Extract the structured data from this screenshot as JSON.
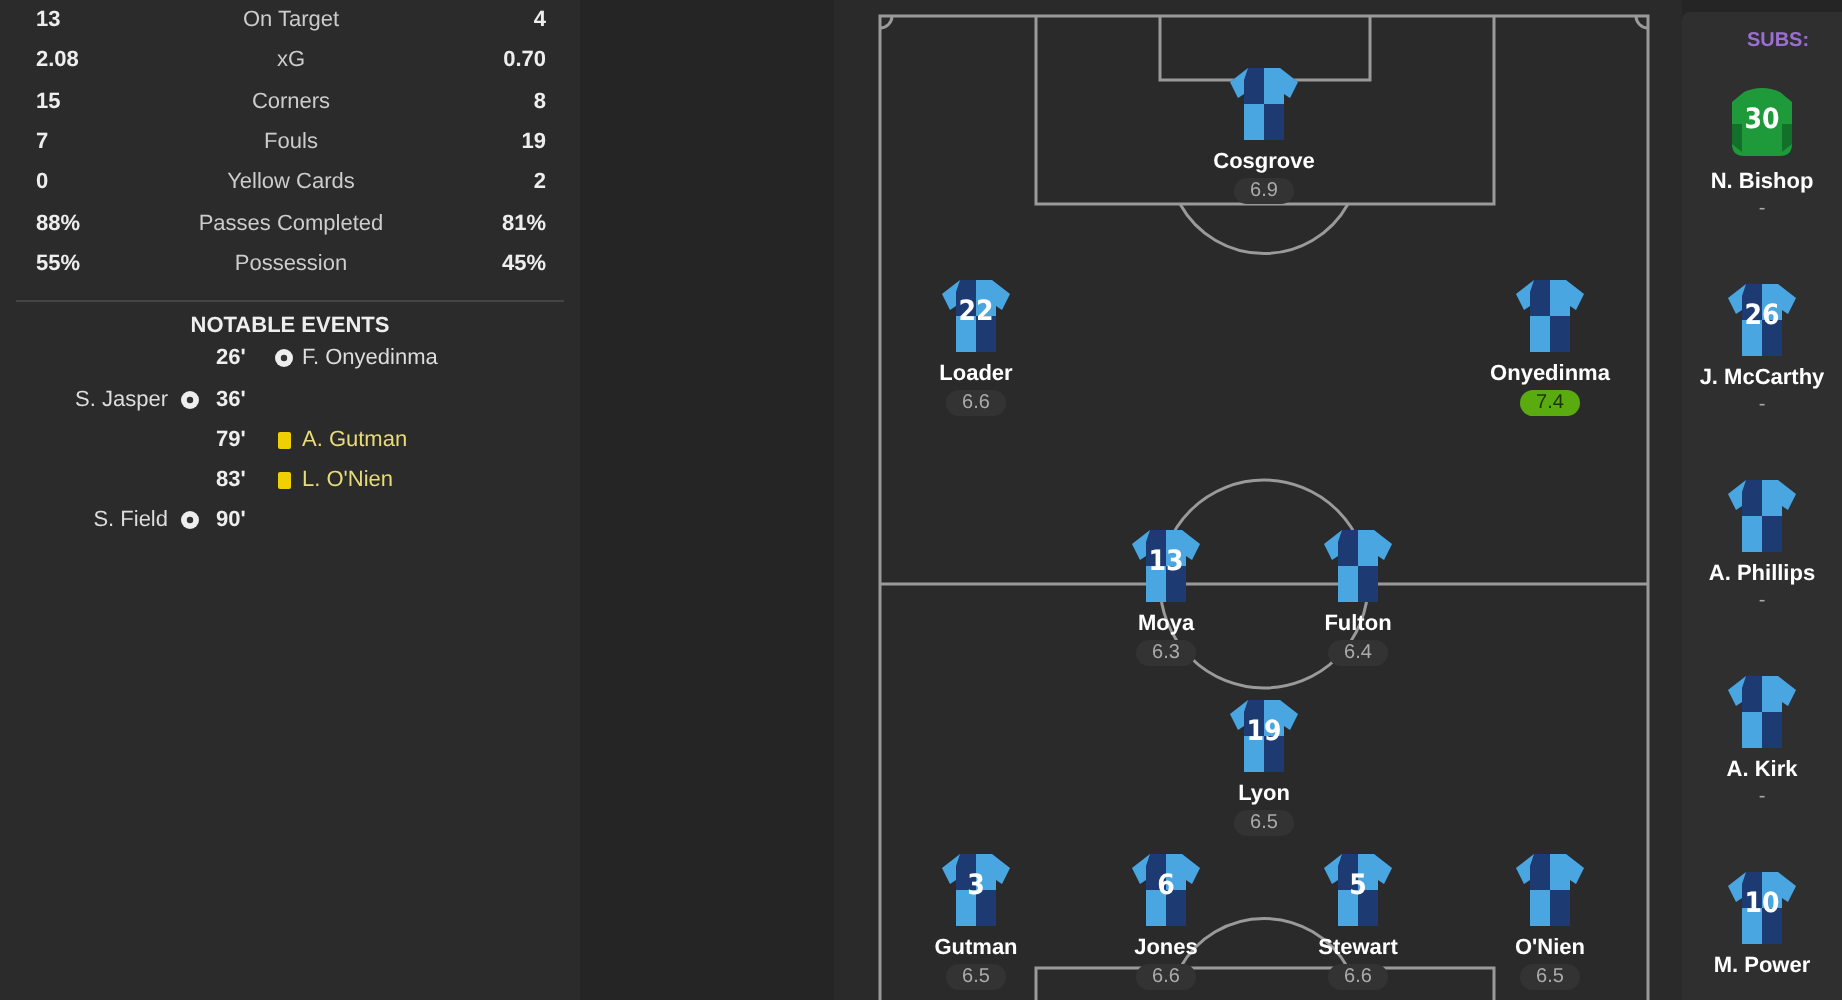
{
  "stats": [
    {
      "home": "13",
      "label": "On Target",
      "away": "4"
    },
    {
      "home": "2.08",
      "label": "xG",
      "away": "0.70"
    },
    {
      "home": "15",
      "label": "Corners",
      "away": "8"
    },
    {
      "home": "7",
      "label": "Fouls",
      "away": "19"
    },
    {
      "home": "0",
      "label": "Yellow Cards",
      "away": "2"
    },
    {
      "home": "88%",
      "label": "Passes Completed",
      "away": "81%"
    },
    {
      "home": "55%",
      "label": "Possession",
      "away": "45%"
    }
  ],
  "events_title": "NOTABLE EVENTS",
  "events": [
    {
      "minute": "26'",
      "away_player": "F. Onyedinma",
      "kind": "goal"
    },
    {
      "minute": "36'",
      "home_player": "S. Jasper",
      "kind": "goal"
    },
    {
      "minute": "79'",
      "away_player": "A. Gutman",
      "kind": "yellow"
    },
    {
      "minute": "83'",
      "away_player": "L. O'Nien",
      "kind": "yellow"
    },
    {
      "minute": "90'",
      "home_player": "S. Field",
      "kind": "goal"
    }
  ],
  "lineup": [
    {
      "name": "Cosgrove",
      "rating": "6.9",
      "best": false
    },
    {
      "name": "Loader",
      "rating": "6.6",
      "best": false,
      "number": "22"
    },
    {
      "name": "Onyedinma",
      "rating": "7.4",
      "best": true
    },
    {
      "name": "Moya",
      "rating": "6.3",
      "best": false,
      "number": "13"
    },
    {
      "name": "Fulton",
      "rating": "6.4",
      "best": false
    },
    {
      "name": "Lyon",
      "rating": "6.5",
      "best": false,
      "number": "19"
    },
    {
      "name": "Gutman",
      "rating": "6.5",
      "best": false,
      "number": "3"
    },
    {
      "name": "Jones",
      "rating": "6.6",
      "best": false,
      "number": "6"
    },
    {
      "name": "Stewart",
      "rating": "6.6",
      "best": false,
      "number": "5"
    },
    {
      "name": "O'Nien",
      "rating": "6.5",
      "best": false
    }
  ],
  "subs_title": "SUBS:",
  "subs": [
    {
      "name": "N. Bishop",
      "rating": "-",
      "number": "30",
      "kind": "goalkeeper"
    },
    {
      "name": "J. McCarthy",
      "rating": "-",
      "number": "26",
      "kind": "outfield"
    },
    {
      "name": "A. Phillips",
      "rating": "-",
      "kind": "outfield"
    },
    {
      "name": "A. Kirk",
      "rating": "-",
      "kind": "outfield"
    },
    {
      "name": "M. Power",
      "number": "10",
      "kind": "outfield"
    }
  ]
}
